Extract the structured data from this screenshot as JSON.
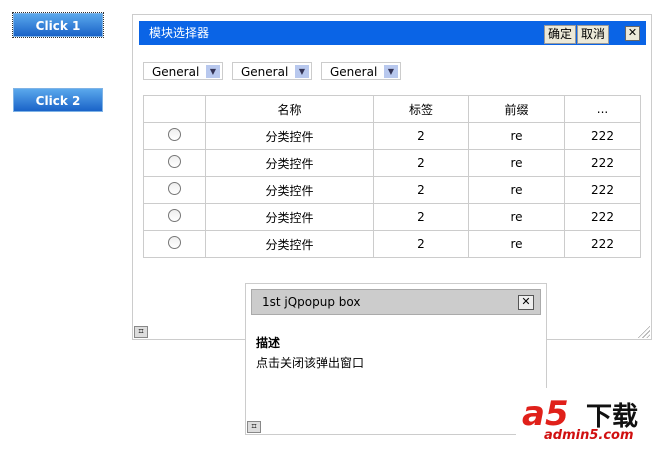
{
  "buttons": {
    "click1": "Click 1",
    "click2": "Click 2"
  },
  "selector": {
    "title": "模块选择器",
    "ok": "确定",
    "cancel": "取消",
    "close": "✕",
    "selects": [
      "General",
      "General",
      "General"
    ],
    "columns": [
      "",
      "名称",
      "标签",
      "前缀",
      "..."
    ],
    "rows": [
      {
        "name": "分类控件",
        "tag": "2",
        "prefix": "re",
        "extra": "222"
      },
      {
        "name": "分类控件",
        "tag": "2",
        "prefix": "re",
        "extra": "222"
      },
      {
        "name": "分类控件",
        "tag": "2",
        "prefix": "re",
        "extra": "222"
      },
      {
        "name": "分类控件",
        "tag": "2",
        "prefix": "re",
        "extra": "222"
      },
      {
        "name": "分类控件",
        "tag": "2",
        "prefix": "re",
        "extra": "222"
      }
    ]
  },
  "popup": {
    "title": "1st jQpopup box",
    "close": "✕",
    "heading": "描述",
    "desc": "点击关闭该弹出窗口"
  },
  "watermark": {
    "logo": "a5",
    "text": "下载",
    "domain": "admin5.com"
  }
}
